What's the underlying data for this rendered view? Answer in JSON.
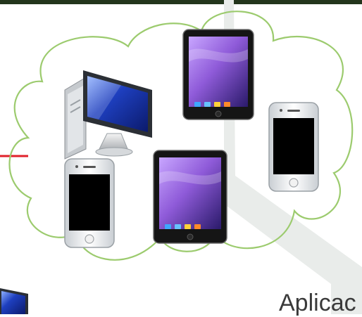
{
  "caption": "Aplicac",
  "colors": {
    "cloud_outline": "#9ccb6e",
    "connector_line": "#e0202a",
    "background_path": "#e9ecea",
    "top_strip": "#23351c",
    "tablet_frame": "#151515",
    "tablet_screen": "#8f5bd9",
    "phone_frame": "#eef0f2",
    "phone_screen": "#000000",
    "monitor_screen": "#1e3fbf"
  },
  "devices": [
    {
      "kind": "tablet",
      "icon": "tablet-icon"
    },
    {
      "kind": "tablet",
      "icon": "tablet-icon"
    },
    {
      "kind": "smartphone",
      "icon": "smartphone-icon"
    },
    {
      "kind": "smartphone",
      "icon": "smartphone-icon"
    },
    {
      "kind": "desktop computer",
      "icon": "desktop-computer-icon"
    },
    {
      "kind": "desktop computer",
      "icon": "desktop-computer-icon"
    }
  ]
}
